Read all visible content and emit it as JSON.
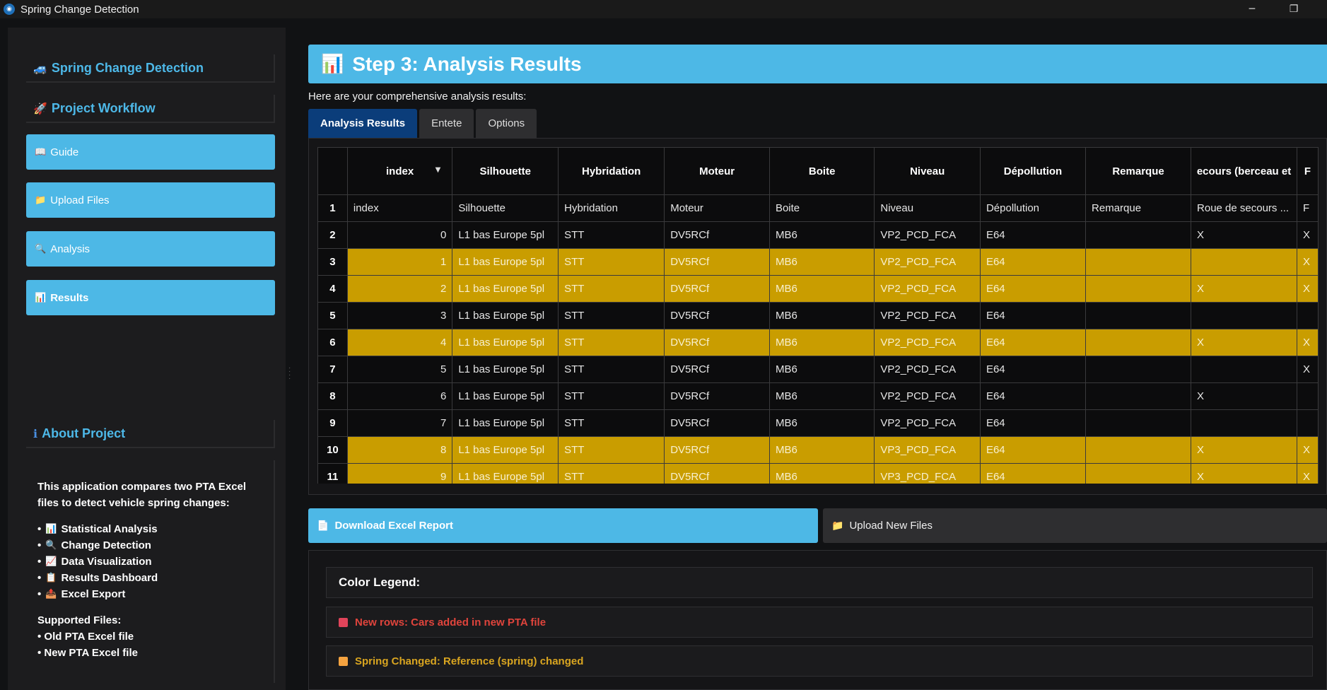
{
  "window": {
    "title": "Spring Change Detection",
    "minimize": "─",
    "maximize": "❐"
  },
  "sidebar": {
    "app_header": {
      "icon": "car-icon",
      "label": "Spring Change Detection"
    },
    "workflow_header": {
      "icon": "rocket-icon",
      "label": "Project Workflow"
    },
    "nav": [
      {
        "icon": "book-icon",
        "label": "Guide"
      },
      {
        "icon": "folder-icon",
        "label": "Upload Files"
      },
      {
        "icon": "magnifier-icon",
        "label": "Analysis"
      },
      {
        "icon": "chart-icon",
        "label": "Results"
      }
    ],
    "about_header": {
      "icon": "info-icon",
      "label": "About Project"
    },
    "about": {
      "intro": "This application compares two PTA Excel files to detect vehicle spring changes:",
      "features": [
        {
          "icon": "chart-icon",
          "label": "Statistical Analysis"
        },
        {
          "icon": "magnifier-icon",
          "label": "Change Detection"
        },
        {
          "icon": "trend-icon",
          "label": "Data Visualization"
        },
        {
          "icon": "clipboard-icon",
          "label": "Results Dashboard"
        },
        {
          "icon": "outbox-icon",
          "label": "Excel Export"
        }
      ],
      "supported_title": "Supported Files:",
      "supported": [
        "• Old PTA Excel file",
        "• New PTA Excel file"
      ]
    }
  },
  "main": {
    "header": {
      "icon": "chart-icon",
      "title": "Step 3: Analysis Results"
    },
    "subtitle": "Here are your comprehensive analysis results:",
    "tabs": [
      "Analysis Results",
      "Entete",
      "Options"
    ],
    "table": {
      "columns": [
        "index",
        "Silhouette",
        "Hybridation",
        "Moteur",
        "Boite",
        "Niveau",
        "Dépollution",
        "Remarque",
        "ecours (berceau et",
        "F"
      ],
      "rows": [
        {
          "n": "1",
          "hl": false,
          "cells": [
            "index",
            "Silhouette",
            "Hybridation",
            "Moteur",
            "Boite",
            "Niveau",
            "Dépollution",
            "Remarque",
            "Roue de secours ...",
            "F"
          ]
        },
        {
          "n": "2",
          "hl": false,
          "cells": [
            "0",
            "L1 bas Europe 5pl",
            "STT",
            "DV5RCf",
            "MB6",
            "VP2_PCD_FCA",
            "E64",
            "",
            "X",
            "X"
          ]
        },
        {
          "n": "3",
          "hl": true,
          "cells": [
            "1",
            "L1 bas Europe 5pl",
            "STT",
            "DV5RCf",
            "MB6",
            "VP2_PCD_FCA",
            "E64",
            "",
            "",
            "X"
          ]
        },
        {
          "n": "4",
          "hl": true,
          "cells": [
            "2",
            "L1 bas Europe 5pl",
            "STT",
            "DV5RCf",
            "MB6",
            "VP2_PCD_FCA",
            "E64",
            "",
            "X",
            "X"
          ]
        },
        {
          "n": "5",
          "hl": false,
          "cells": [
            "3",
            "L1 bas Europe 5pl",
            "STT",
            "DV5RCf",
            "MB6",
            "VP2_PCD_FCA",
            "E64",
            "",
            "",
            ""
          ]
        },
        {
          "n": "6",
          "hl": true,
          "cells": [
            "4",
            "L1 bas Europe 5pl",
            "STT",
            "DV5RCf",
            "MB6",
            "VP2_PCD_FCA",
            "E64",
            "",
            "X",
            "X"
          ]
        },
        {
          "n": "7",
          "hl": false,
          "cells": [
            "5",
            "L1 bas Europe 5pl",
            "STT",
            "DV5RCf",
            "MB6",
            "VP2_PCD_FCA",
            "E64",
            "",
            "",
            "X"
          ]
        },
        {
          "n": "8",
          "hl": false,
          "cells": [
            "6",
            "L1 bas Europe 5pl",
            "STT",
            "DV5RCf",
            "MB6",
            "VP2_PCD_FCA",
            "E64",
            "",
            "X",
            ""
          ]
        },
        {
          "n": "9",
          "hl": false,
          "cells": [
            "7",
            "L1 bas Europe 5pl",
            "STT",
            "DV5RCf",
            "MB6",
            "VP2_PCD_FCA",
            "E64",
            "",
            "",
            ""
          ]
        },
        {
          "n": "10",
          "hl": true,
          "cells": [
            "8",
            "L1 bas Europe 5pl",
            "STT",
            "DV5RCf",
            "MB6",
            "VP3_PCD_FCA",
            "E64",
            "",
            "X",
            "X"
          ]
        },
        {
          "n": "11",
          "hl": true,
          "cells": [
            "9",
            "L1 bas Europe 5pl",
            "STT",
            "DV5RCf",
            "MB6",
            "VP3_PCD_FCA",
            "E64",
            "",
            "X",
            "X"
          ]
        }
      ]
    },
    "actions": {
      "download": {
        "icon": "document-icon",
        "label": "Download Excel Report"
      },
      "upload": {
        "icon": "folder-icon",
        "label": "Upload New Files"
      }
    },
    "legend": {
      "title": "Color Legend:",
      "items": [
        {
          "label": "New rows: Cars added in new PTA file",
          "color": "#e0443c",
          "swatch": "#e0445a"
        },
        {
          "label": "Spring Changed: Reference (spring) changed",
          "color": "#d9a520",
          "swatch": "#f5a340"
        }
      ]
    }
  },
  "colors": {
    "accent": "#4db8e6",
    "highlight": "#c99d00",
    "active_tab": "#0b3d7a"
  }
}
